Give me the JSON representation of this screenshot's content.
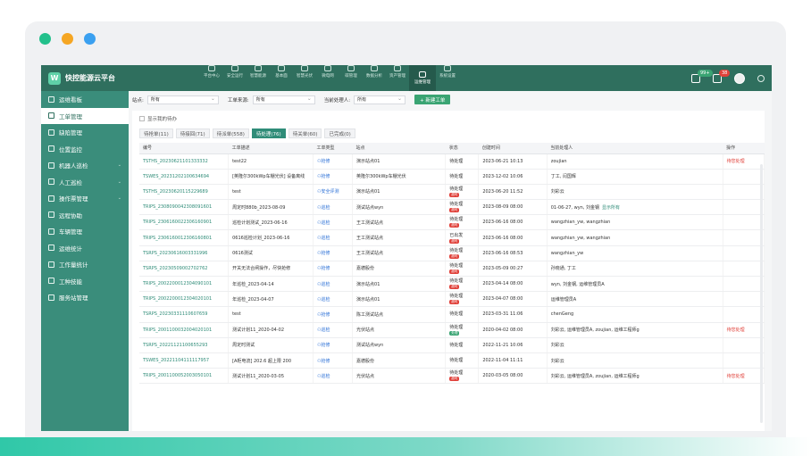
{
  "colors": {
    "accent": "#2f8c78",
    "nav": "#2f6f5e",
    "sidebar": "#3a8d7b",
    "red": "#e0413a",
    "green": "#3aa473",
    "dot_green": "#22c08b",
    "dot_orange": "#f5a623",
    "dot_blue": "#3aa0f0"
  },
  "app": {
    "title": "快控能源云平台"
  },
  "nav": {
    "modules": [
      {
        "label": "平台中心",
        "icon": "platform-icon"
      },
      {
        "label": "安全运行",
        "icon": "shield-icon"
      },
      {
        "label": "智慧能源",
        "icon": "energy-icon"
      },
      {
        "label": "基本面",
        "icon": "chart-icon"
      },
      {
        "label": "智慧光伏",
        "icon": "solar-icon"
      },
      {
        "label": "微电网",
        "icon": "grid-icon"
      },
      {
        "label": "碳管理",
        "icon": "leaf-icon"
      },
      {
        "label": "数据分析",
        "icon": "analytics-icon"
      },
      {
        "label": "资产管理",
        "icon": "asset-icon"
      },
      {
        "label": "运维管理",
        "icon": "tools-icon"
      },
      {
        "label": "系统设置",
        "icon": "settings-icon"
      }
    ],
    "badges": {
      "messages": "99+",
      "alerts": "38"
    }
  },
  "sidebar": {
    "items": [
      {
        "label": "运维看板",
        "icon": "dashboard-icon"
      },
      {
        "label": "工单管理",
        "icon": "order-icon"
      },
      {
        "label": "缺陷管理",
        "icon": "defect-icon"
      },
      {
        "label": "位置监控",
        "icon": "location-icon"
      },
      {
        "label": "机器人巡检",
        "icon": "robot-icon",
        "chev": "⌄"
      },
      {
        "label": "人工巡检",
        "icon": "person-icon",
        "chev": "⌄"
      },
      {
        "label": "操作票管理",
        "icon": "ticket-icon",
        "chev": "⌄"
      },
      {
        "label": "远程协助",
        "icon": "remote-icon"
      },
      {
        "label": "车辆管理",
        "icon": "car-icon"
      },
      {
        "label": "运维统计",
        "icon": "stats-icon"
      },
      {
        "label": "工作量统计",
        "icon": "workload-icon"
      },
      {
        "label": "工种技能",
        "icon": "skill-icon"
      },
      {
        "label": "服务站管理",
        "icon": "station-icon"
      }
    ]
  },
  "filters": {
    "site_label": "站点:",
    "site_value": "所有",
    "source_label": "工单来源:",
    "source_value": "所有",
    "handler_label": "当前处理人:",
    "handler_value": "所有",
    "new_button": "+ 新建工单"
  },
  "panel": {
    "mine_label": "显示我的待办",
    "tabs": [
      "待抢单(11)",
      "待接回(71)",
      "待派单(558)",
      "待处理(76)",
      "待关单(60)",
      "已完成(0)"
    ],
    "active_tab": 3,
    "columns": [
      "编号",
      "工单描述",
      "工单类型",
      "站点",
      "状态",
      "创建时间",
      "当前处理人",
      "操作"
    ],
    "rows": [
      {
        "code": "TSTHS_20230621101333332",
        "desc": "test22",
        "type": "抢修",
        "site": "演示站点01",
        "status": "待处理",
        "tag": "",
        "tag_color": "",
        "time": "2023-06-21 10:13",
        "handler": "zoujian",
        "op": "待您处理"
      },
      {
        "code": "TSWES_20231202100634694",
        "desc": "[英隆尔300kWp车棚光伏] 设备离线",
        "type": "抢修",
        "site": "英隆尔300kWp车棚光伏",
        "status": "待处理",
        "tag": "",
        "tag_color": "",
        "time": "2023-12-02 10:06",
        "handler": "丁工, 闫国辉",
        "op": ""
      },
      {
        "code": "TSTHS_20230620115229689",
        "desc": "test",
        "type": "安全评测",
        "site": "演示站点01",
        "status": "待处理",
        "tag": "超时",
        "tag_color": "red",
        "time": "2023-06-20 11:52",
        "handler": "刘彩云",
        "op": ""
      },
      {
        "code": "TRIPS_2308090042308091601",
        "desc": "周定时880b_2023-08-09",
        "type": "巡检",
        "site": "测试站点wyn",
        "status": "待处理",
        "tag": "超时",
        "tag_color": "red",
        "time": "2023-08-09 08:00",
        "handler": "01-06-27, wyn, 刘金钢",
        "more": "显示所有",
        "op": ""
      },
      {
        "code": "TRIPS_2306160022306160901",
        "desc": "巡检计划测试_2023-06-16",
        "type": "巡检",
        "site": "王工测试站点",
        "status": "待处理",
        "tag": "超时",
        "tag_color": "red",
        "time": "2023-06-16 08:00",
        "handler": "wangzhian_yw, wangzhian",
        "op": ""
      },
      {
        "code": "TRIPS_2306160012306160801",
        "desc": "0616巡检计划_2023-06-16",
        "type": "巡检",
        "site": "王工测试站点",
        "status": "已出发",
        "tag": "超时",
        "tag_color": "red",
        "time": "2023-06-16 08:00",
        "handler": "wangzhian_yw, wangzhian",
        "op": ""
      },
      {
        "code": "TSRPS_20230616003331996",
        "desc": "0616测试",
        "type": "抢修",
        "site": "王工测试站点",
        "status": "待处理",
        "tag": "超时",
        "tag_color": "red",
        "time": "2023-06-16 08:53",
        "handler": "wangzhian_yw",
        "op": ""
      },
      {
        "code": "TSRPS_20230509002702762",
        "desc": "开关无法合闸操作，尽快抢修",
        "type": "抢修",
        "site": "嘉德股份",
        "status": "待处理",
        "tag": "超时",
        "tag_color": "red",
        "time": "2023-05-09 00:27",
        "handler": "孙晓通, 丁工",
        "op": ""
      },
      {
        "code": "TRIPS_2002200012304090101",
        "desc": "年巡检_2023-04-14",
        "type": "巡检",
        "site": "演示站点01",
        "status": "待处理",
        "tag": "超时",
        "tag_color": "red",
        "time": "2023-04-14 08:00",
        "handler": "wyn, 刘金钢, 运维管理员A",
        "op": ""
      },
      {
        "code": "TRIPS_2002200012304020101",
        "desc": "年巡检_2023-04-07",
        "type": "巡检",
        "site": "演示站点01",
        "status": "待处理",
        "tag": "超时",
        "tag_color": "red",
        "time": "2023-04-07 08:00",
        "handler": "运维管理员A",
        "op": ""
      },
      {
        "code": "TSRPS_20230331110607659",
        "desc": "test",
        "type": "抢修",
        "site": "陈工测试站点",
        "status": "待处理",
        "tag": "",
        "tag_color": "",
        "time": "2023-03-31 11:06",
        "handler": "chenGeng",
        "op": ""
      },
      {
        "code": "TRIPS_2001100032004020101",
        "desc": "测试计划11_2020-04-02",
        "type": "巡检",
        "site": "光伏站点",
        "status": "待处理",
        "tag": "处理",
        "tag_color": "green",
        "time": "2020-04-02 08:00",
        "handler": "刘彩云, 运维管理员A, zoujian, 运维工程师g",
        "op": "待您处理"
      },
      {
        "code": "TSRPS_20221121100655293",
        "desc": "周定时测试",
        "type": "抢修",
        "site": "测试站点wyn",
        "status": "待处理",
        "tag": "",
        "tag_color": "",
        "time": "2022-11-21 10:06",
        "handler": "刘彩云",
        "op": ""
      },
      {
        "code": "TSWES_20221104111117957",
        "desc": "[A柜电流] 202.6 超上限 200",
        "type": "抢修",
        "site": "嘉德股份",
        "status": "待处理",
        "tag": "",
        "tag_color": "",
        "time": "2022-11-04 11:11",
        "handler": "刘彩云",
        "op": ""
      },
      {
        "code": "TRIPS_2001100052003050101",
        "desc": "测试计划11_2020-03-05",
        "type": "巡检",
        "site": "光伏站点",
        "status": "待处理",
        "tag": "超时",
        "tag_color": "red",
        "time": "2020-03-05 08:00",
        "handler": "刘彩云, 运维管理员A, zoujian, 运维工程师g",
        "op": "待您处理"
      }
    ]
  }
}
